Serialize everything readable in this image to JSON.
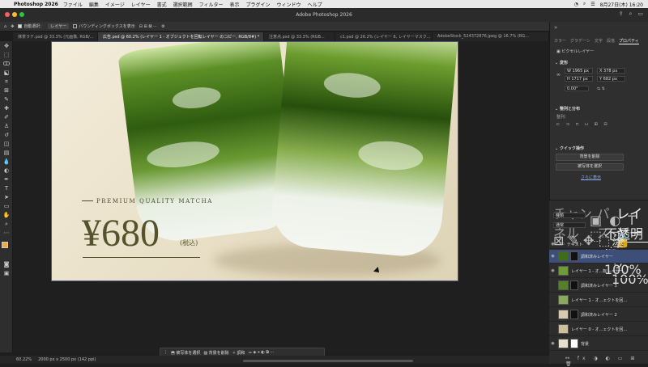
{
  "menubar": {
    "app": "Photoshop 2026",
    "menus": [
      "ファイル",
      "編集",
      "イメージ",
      "レイヤー",
      "書式",
      "選択範囲",
      "フィルター",
      "表示",
      "プラグイン",
      "ウィンドウ",
      "ヘルプ"
    ],
    "clock": "8月27日(木) 16:20"
  },
  "window": {
    "title": "Adobe Photoshop 2026"
  },
  "options": {
    "autoselect_label": "自動選択：",
    "autoselect_value": "レイヤー",
    "bbox_label": "バウンディングボックスを表示"
  },
  "tabs": [
    "抹茶ラテ.psd @ 33.3% (元画像, RGB/...",
    "広告.psd @ 60.2% (レイヤー 1 - オブジェクトを回転レイヤー のコピー, RGB/8#) *",
    "注意点.psd @ 33.3% (RGB...",
    "c1.psd @ 26.2% (レイヤー 6, レイヤーマスク...",
    "AdobeStock_524372876.jpeg @ 16.7% (RG..."
  ],
  "canvas": {
    "premium": "PREMIUM QUALITY MATCHA",
    "price": "¥680",
    "tax": "(税込)"
  },
  "contextbar": {
    "select_subject": "被写体を選択",
    "remove_bg": "背景を削除",
    "adjust": "調和"
  },
  "status": {
    "zoom": "60.22%",
    "docsize": "2000 px x 2500 px (142 ppi)"
  },
  "properties": {
    "tabs": [
      "カラー",
      "グラデーシ",
      "文字",
      "段落",
      "プロパティ"
    ],
    "kind": "ピクセルレイヤー",
    "transform_title": "変形",
    "w": "W 1965 px",
    "h": "H 1717 px",
    "x": "X 378 px",
    "y": "Y 682 px",
    "angle": "0.00°",
    "align_title": "整列と分布",
    "align_label": "整列：",
    "quick_title": "クイック操作",
    "btn_remove_bg": "背景を削除",
    "btn_select_subject": "被写体を選択",
    "more": "さらに表示"
  },
  "layers_panel": {
    "tabs": [
      "チャンネル",
      "パス",
      "レイヤー"
    ],
    "filter": "種類",
    "blend": "通常",
    "opacity_label": "不透明度：",
    "opacity": "100%",
    "fill_label": "塗り：",
    "fill": "100%",
    "items": [
      "テキスト",
      "調和済みレイヤー",
      "レイヤー 1 - オ...転レイヤー のコピー",
      "調和済みレイヤー 3",
      "レイヤー 1 - オ...ェクトを回転レイヤー",
      "調和済みレイヤー 2",
      "レイヤー 0 - オ...ェクトを回転レイヤー",
      "背景"
    ]
  }
}
